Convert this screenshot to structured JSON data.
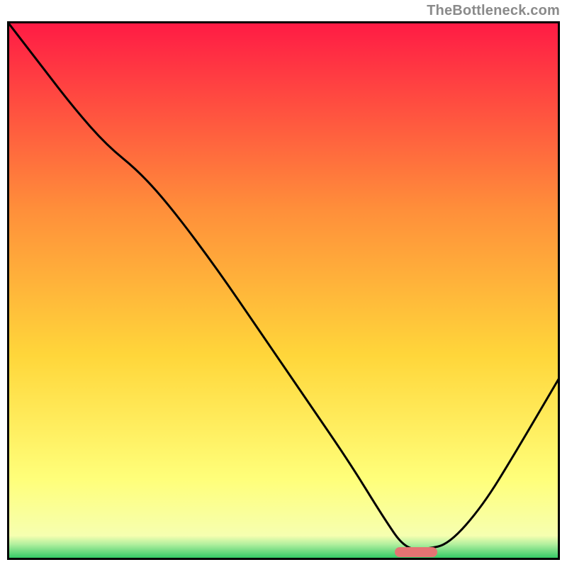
{
  "watermark": "TheBottleneck.com",
  "colors": {
    "gradient_top": "#ff1a45",
    "gradient_upper_mid": "#ff8f3a",
    "gradient_mid": "#ffd63a",
    "gradient_lower_yellow": "#ffff7a",
    "gradient_green_thin": "#22c55e",
    "frame": "#000000",
    "curve": "#000000",
    "pill": "#e57373"
  },
  "plot": {
    "viewbox_w": 780,
    "viewbox_h": 760,
    "gradient_stops": [
      {
        "offset": 0.0,
        "color": "#ff1a45"
      },
      {
        "offset": 0.35,
        "color": "#ff8f3a"
      },
      {
        "offset": 0.62,
        "color": "#ffd63a"
      },
      {
        "offset": 0.85,
        "color": "#ffff7a"
      },
      {
        "offset": 0.955,
        "color": "#f6ffb0"
      },
      {
        "offset": 0.97,
        "color": "#b6f0a0"
      },
      {
        "offset": 1.0,
        "color": "#22c55e"
      }
    ],
    "pill": {
      "x_frac": 0.74,
      "y_frac": 0.985,
      "w": 60,
      "h": 14
    }
  },
  "chart_data": {
    "type": "line",
    "title": "",
    "xlabel": "",
    "ylabel": "",
    "xlim": [
      0,
      1
    ],
    "ylim": [
      0,
      1
    ],
    "series": [
      {
        "name": "bottleneck_curve",
        "x": [
          0.0,
          0.06,
          0.12,
          0.18,
          0.24,
          0.3,
          0.38,
          0.46,
          0.54,
          0.62,
          0.68,
          0.72,
          0.76,
          0.8,
          0.86,
          0.92,
          1.0
        ],
        "values": [
          1.0,
          0.92,
          0.84,
          0.77,
          0.72,
          0.65,
          0.54,
          0.42,
          0.3,
          0.18,
          0.08,
          0.02,
          0.02,
          0.03,
          0.1,
          0.2,
          0.34
        ]
      }
    ],
    "marker": {
      "description": "optimum range indicator",
      "x_center_frac": 0.74,
      "y_frac": 0.015,
      "width_frac": 0.077,
      "color": "#e57373"
    },
    "background_gradient": {
      "direction": "top-to-bottom",
      "stops": [
        {
          "pos": 0.0,
          "color": "#ff1a45"
        },
        {
          "pos": 0.35,
          "color": "#ff8f3a"
        },
        {
          "pos": 0.62,
          "color": "#ffd63a"
        },
        {
          "pos": 0.85,
          "color": "#ffff7a"
        },
        {
          "pos": 0.955,
          "color": "#f6ffb0"
        },
        {
          "pos": 0.97,
          "color": "#b6f0a0"
        },
        {
          "pos": 1.0,
          "color": "#22c55e"
        }
      ]
    }
  }
}
